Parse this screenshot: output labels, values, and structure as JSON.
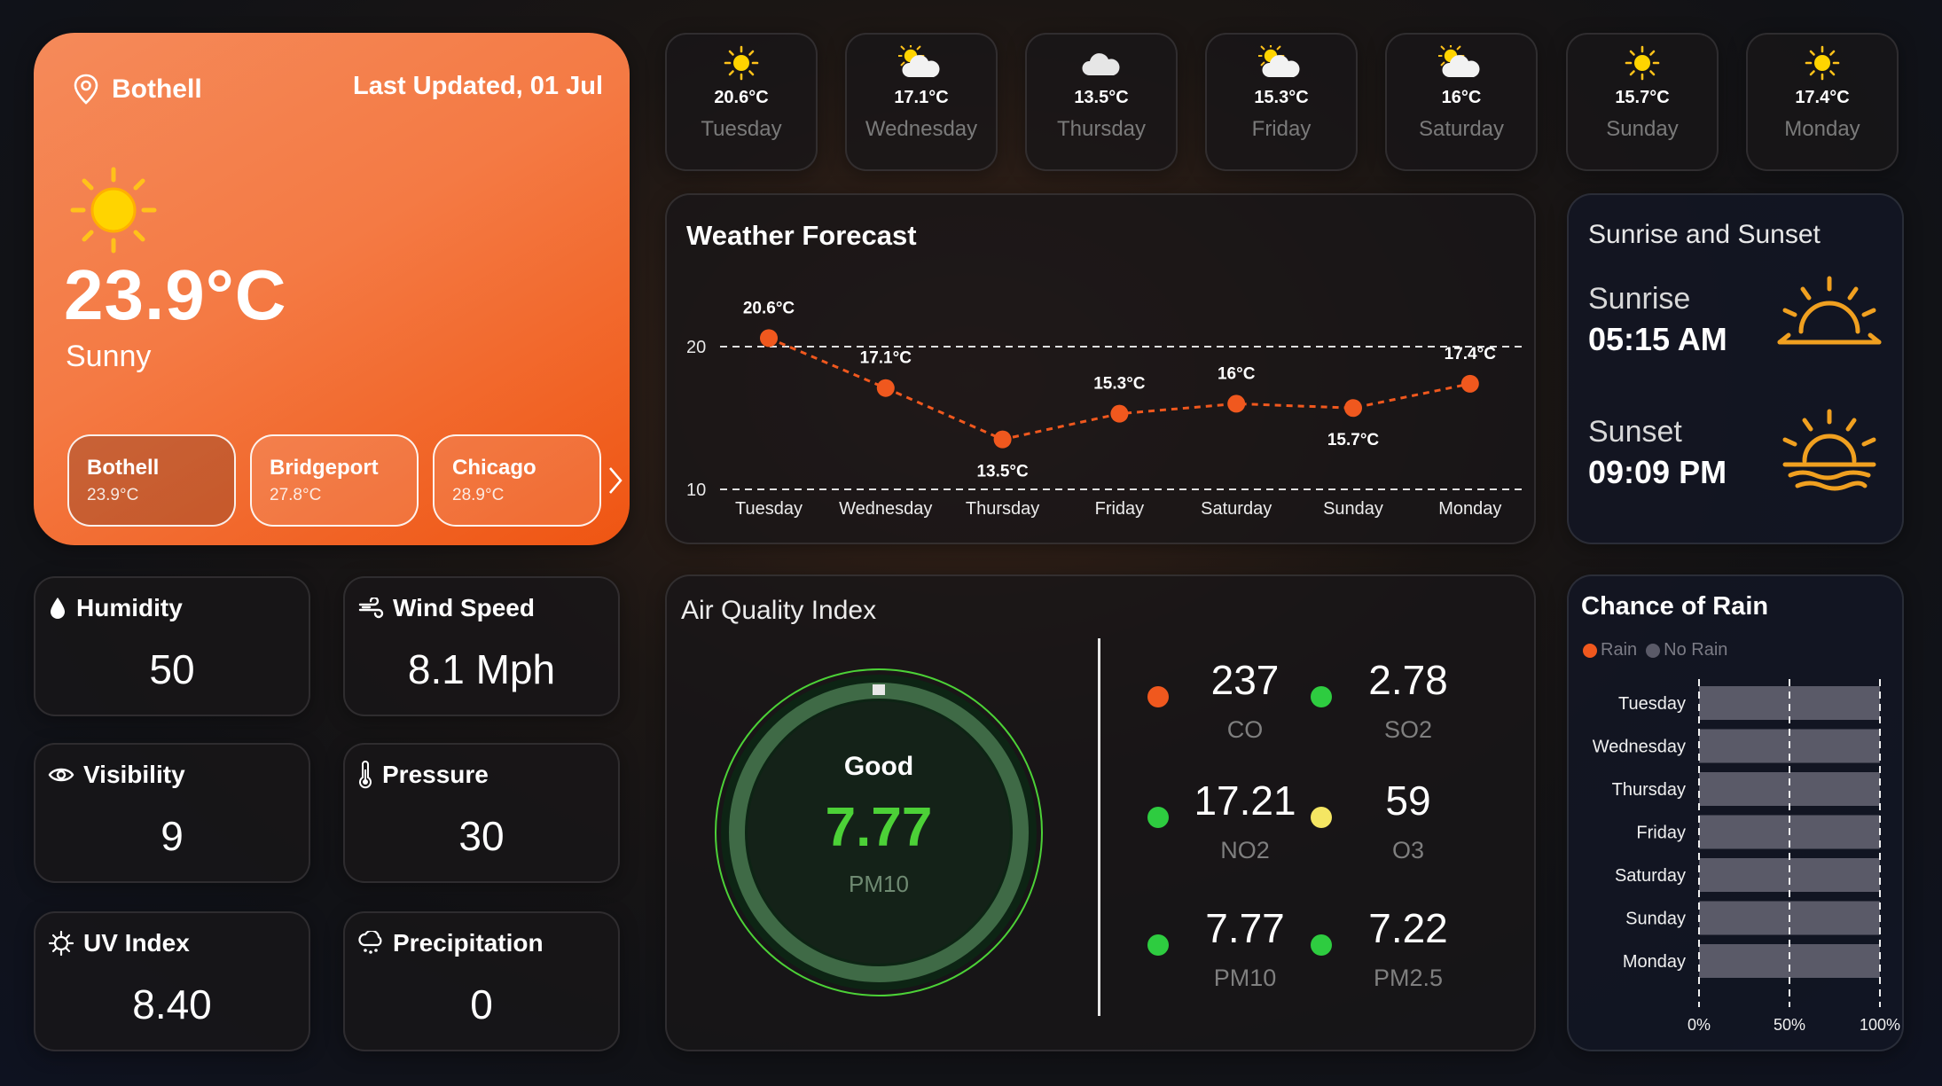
{
  "current": {
    "location": "Bothell",
    "last_updated": "Last Updated, 01 Jul",
    "temperature": "23.9°C",
    "condition": "Sunny",
    "icon": "sun-icon"
  },
  "cities": [
    {
      "name": "Bothell",
      "temp": "23.9°C"
    },
    {
      "name": "Bridgeport",
      "temp": "27.8°C"
    },
    {
      "name": "Chicago",
      "temp": "28.9°C"
    }
  ],
  "days": [
    {
      "temp": "20.6°C",
      "name": "Tuesday",
      "icon": "sun-icon"
    },
    {
      "temp": "17.1°C",
      "name": "Wednesday",
      "icon": "partly-cloudy-icon"
    },
    {
      "temp": "13.5°C",
      "name": "Thursday",
      "icon": "cloud-icon"
    },
    {
      "temp": "15.3°C",
      "name": "Friday",
      "icon": "partly-cloudy-icon"
    },
    {
      "temp": "16°C",
      "name": "Saturday",
      "icon": "partly-cloudy-icon"
    },
    {
      "temp": "15.7°C",
      "name": "Sunday",
      "icon": "sun-icon"
    },
    {
      "temp": "17.4°C",
      "name": "Monday",
      "icon": "sun-icon"
    }
  ],
  "forecast": {
    "title": "Weather Forecast",
    "chart_data": {
      "type": "line",
      "categories": [
        "Tuesday",
        "Wednesday",
        "Thursday",
        "Friday",
        "Saturday",
        "Sunday",
        "Monday"
      ],
      "values": [
        20.6,
        17.1,
        13.5,
        15.3,
        16.0,
        15.7,
        17.4
      ],
      "data_labels": [
        "20.6°C",
        "17.1°C",
        "13.5°C",
        "15.3°C",
        "16°C",
        "15.7°C",
        "17.4°C"
      ],
      "yticks": [
        10,
        20
      ],
      "ylim": [
        10,
        20
      ],
      "line_color": "#f0581e",
      "grid": "dashed"
    }
  },
  "sun": {
    "title": "Sunrise and Sunset",
    "sunrise_label": "Sunrise",
    "sunrise_time": "05:15 AM",
    "sunset_label": "Sunset",
    "sunset_time": "09:09 PM",
    "icon_color": "#f0a020"
  },
  "metrics": {
    "humidity": {
      "label": "Humidity",
      "value": "50"
    },
    "wind": {
      "label": "Wind Speed",
      "value": "8.1 Mph"
    },
    "visibility": {
      "label": "Visibility",
      "value": "9"
    },
    "pressure": {
      "label": "Pressure",
      "value": "30"
    },
    "uv": {
      "label": "UV Index",
      "value": "8.40"
    },
    "precip": {
      "label": "Precipitation",
      "value": "0"
    }
  },
  "aqi": {
    "title": "Air Quality Index",
    "status": "Good",
    "value": "7.77",
    "metric": "PM10",
    "accent": "#4cd137",
    "items": [
      {
        "value": "237",
        "name": "CO",
        "color": "#f0581e"
      },
      {
        "value": "2.78",
        "name": "SO2",
        "color": "#2ecc40"
      },
      {
        "value": "17.21",
        "name": "NO2",
        "color": "#2ecc40"
      },
      {
        "value": "59",
        "name": "O3",
        "color": "#f5e663"
      },
      {
        "value": "7.77",
        "name": "PM10",
        "color": "#2ecc40"
      },
      {
        "value": "7.22",
        "name": "PM2.5",
        "color": "#2ecc40"
      }
    ]
  },
  "rain": {
    "title": "Chance of Rain",
    "legend": [
      {
        "label": "Rain",
        "color": "#f0581e"
      },
      {
        "label": "No Rain",
        "color": "#5a5a68"
      }
    ],
    "chart_data": {
      "type": "bar",
      "orientation": "horizontal",
      "stacked": true,
      "categories": [
        "Tuesday",
        "Wednesday",
        "Thursday",
        "Friday",
        "Saturday",
        "Sunday",
        "Monday"
      ],
      "series": [
        {
          "name": "Rain",
          "values": [
            0,
            0,
            0,
            0,
            0,
            0,
            0
          ]
        },
        {
          "name": "No Rain",
          "values": [
            100,
            100,
            100,
            100,
            100,
            100,
            100
          ]
        }
      ],
      "xticks": [
        "0%",
        "50%",
        "100%"
      ],
      "xlim": [
        0,
        100
      ]
    }
  }
}
